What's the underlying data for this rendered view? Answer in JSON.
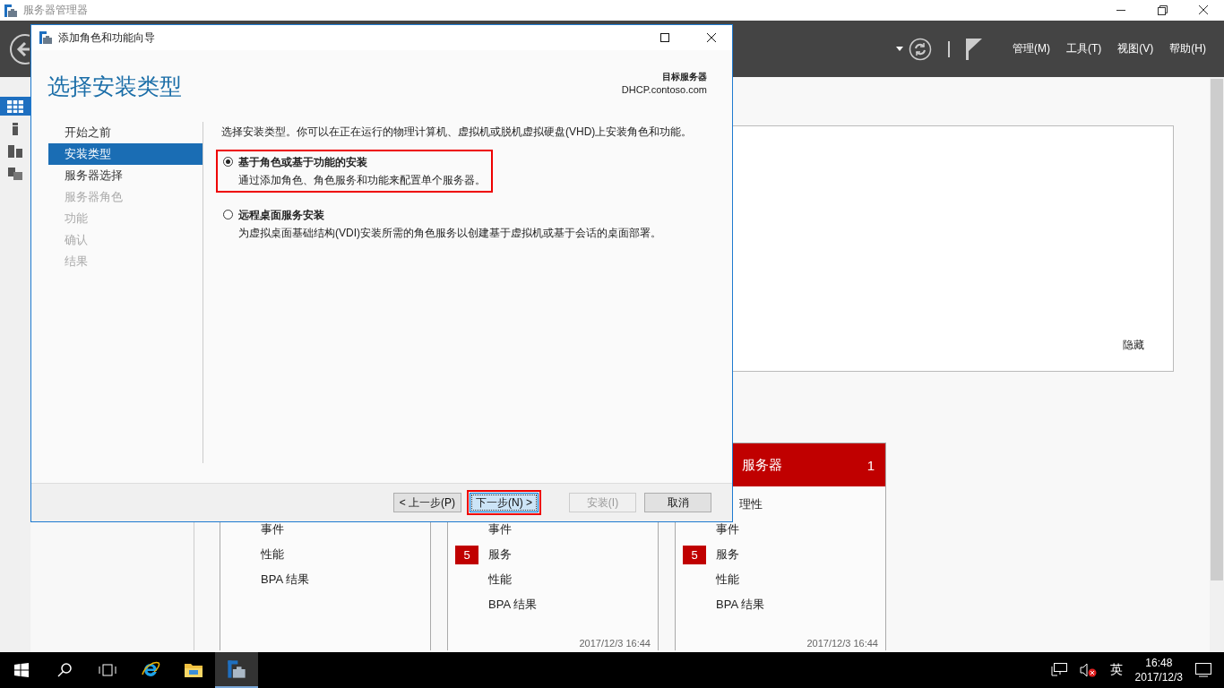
{
  "app": {
    "title": "服务器管理器",
    "menu": [
      "管理(M)",
      "工具(T)",
      "视图(V)",
      "帮助(H)"
    ]
  },
  "welcome_panel": {
    "hide_link": "隐藏"
  },
  "tiles": [
    {
      "items": [
        {
          "label": "事件"
        },
        {
          "label": "性能"
        },
        {
          "label": "BPA 结果"
        }
      ]
    },
    {
      "items": [
        {
          "label": "事件"
        },
        {
          "label": "服务",
          "badge": "5"
        },
        {
          "label": "性能"
        },
        {
          "label": "BPA 结果"
        }
      ],
      "timestamp": "2017/12/3 16:44"
    },
    {
      "title": "服务器",
      "count": "1",
      "items": [
        {
          "label": "理性",
          "cut": true
        },
        {
          "label": "事件"
        },
        {
          "label": "服务",
          "badge": "5"
        },
        {
          "label": "性能"
        },
        {
          "label": "BPA 结果"
        }
      ],
      "timestamp": "2017/12/3 16:44"
    }
  ],
  "wizard": {
    "title": "添加角色和功能向导",
    "heading": "选择安装类型",
    "target_label": "目标服务器",
    "target": "DHCP.contoso.com",
    "steps": [
      {
        "label": "开始之前",
        "selected": false,
        "disabled": false
      },
      {
        "label": "安装类型",
        "selected": true,
        "disabled": false
      },
      {
        "label": "服务器选择",
        "selected": false,
        "disabled": false
      },
      {
        "label": "服务器角色",
        "selected": false,
        "disabled": true
      },
      {
        "label": "功能",
        "selected": false,
        "disabled": true
      },
      {
        "label": "确认",
        "selected": false,
        "disabled": true
      },
      {
        "label": "结果",
        "selected": false,
        "disabled": true
      }
    ],
    "intro": "选择安装类型。你可以在正在运行的物理计算机、虚拟机或脱机虚拟硬盘(VHD)上安装角色和功能。",
    "options": [
      {
        "title": "基于角色或基于功能的安装",
        "description": "通过添加角色、角色服务和功能来配置单个服务器。",
        "selected": true,
        "highlighted": true
      },
      {
        "title": "远程桌面服务安装",
        "description": "为虚拟桌面基础结构(VDI)安装所需的角色服务以创建基于虚拟机或基于会话的桌面部署。",
        "selected": false,
        "highlighted": false
      }
    ],
    "buttons": [
      {
        "label": "< 上一步(P)",
        "disabled": false,
        "focused": false,
        "highlighted": false
      },
      {
        "label": "下一步(N) >",
        "disabled": false,
        "focused": true,
        "highlighted": true
      },
      {
        "label": "安装(I)",
        "disabled": true,
        "focused": false,
        "highlighted": false
      },
      {
        "label": "取消",
        "disabled": false,
        "focused": false,
        "highlighted": false
      }
    ]
  },
  "taskbar": {
    "language": "英",
    "time": "16:48",
    "date": "2017/12/3"
  }
}
